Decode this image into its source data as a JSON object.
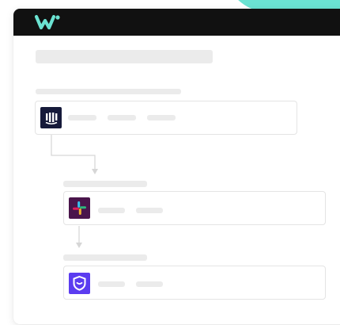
{
  "colors": {
    "accent": "#6be3d2",
    "titlebar": "#111111",
    "skeleton": "#ebebeb",
    "step1_icon": "#161a3a",
    "step2_icon": "#4a154b",
    "step3_icon": "#5b3cf0"
  },
  "icons": {
    "brand": "w-logo-icon",
    "step1": "intercom-logo-icon",
    "step2": "slack-logo-icon",
    "step3": "shield-logo-icon"
  }
}
